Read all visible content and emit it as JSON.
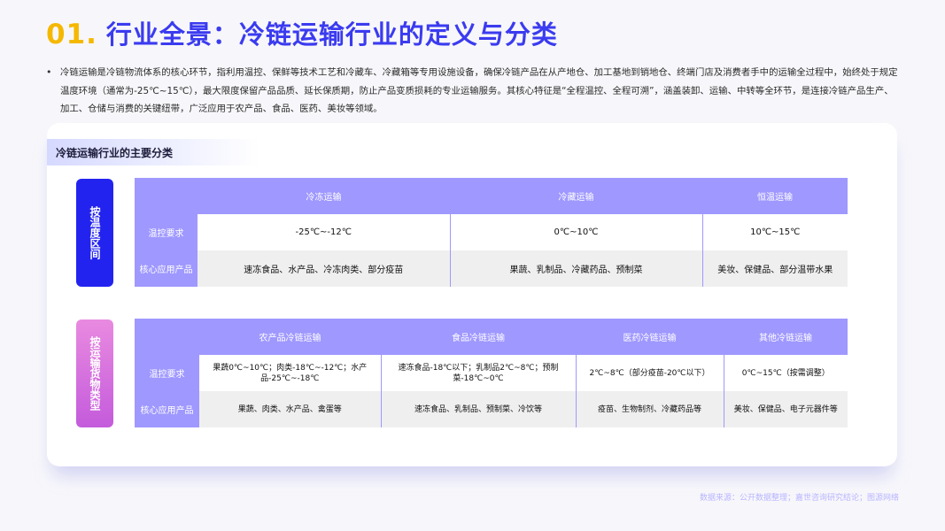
{
  "title": {
    "number": "01.",
    "text": "行业全景：冷链运输行业的定义与分类"
  },
  "intro": {
    "bullet": "•",
    "text": "冷链运输是冷链物流体系的核心环节，指利用温控、保鲜等技术工艺和冷藏车、冷藏箱等专用设施设备，确保冷链产品在从产地仓、加工基地到销地仓、终端门店及消费者手中的运输全过程中，始终处于规定温度环境（通常为-25℃~15℃），最大限度保留产品品质、延长保质期，防止产品变质损耗的专业运输服务。其核心特征是“全程温控、全程可溯”，涵盖装卸、运输、中转等全环节，是连接冷链产品生产、加工、仓储与消费的关键纽带，广泛应用于农产品、食品、医药、美妆等领域。"
  },
  "section_title": "冷链运输行业的主要分类",
  "by_temperature": {
    "label": "按温度区间",
    "columns": [
      "冷冻运输",
      "冷藏运输",
      "恒温运输"
    ],
    "rows": [
      {
        "header": "温控要求",
        "cells": [
          "-25℃~-12℃",
          "0℃~10℃",
          "10℃~15℃"
        ]
      },
      {
        "header": "核心应用产品",
        "cells": [
          "速冻食品、水产品、冷冻肉类、部分疫苗",
          "果蔬、乳制品、冷藏药品、预制菜",
          "美妆、保健品、部分温带水果"
        ]
      }
    ]
  },
  "by_goods": {
    "label": "按运输货物类型",
    "columns": [
      "农产品冷链运输",
      "食品冷链运输",
      "医药冷链运输",
      "其他冷链运输"
    ],
    "rows": [
      {
        "header": "温控要求",
        "cells": [
          "果蔬0℃~10℃；肉类-18℃~-12℃；水产品-25℃~-18℃",
          "速冻食品-18℃以下；乳制品2℃~8℃；预制菜-18℃~0℃",
          "2℃~8℃（部分疫苗-20℃以下）",
          "0℃~15℃（按需调整）"
        ]
      },
      {
        "header": "核心应用产品",
        "cells": [
          "果蔬、肉类、水产品、禽蛋等",
          "速冻食品、乳制品、预制菜、冷饮等",
          "疫苗、生物制剂、冷藏药品等",
          "美妆、保健品、电子元器件等"
        ]
      }
    ]
  },
  "source": "数据来源：公开数据整理；嘉世咨询研究结论；图源网络",
  "colors": {
    "title_number": "#f5b800",
    "title_text": "#3b3bf0",
    "table_header": "#9f98ff",
    "label_blue": "#2323f0",
    "label_pink": "#d46fde"
  }
}
